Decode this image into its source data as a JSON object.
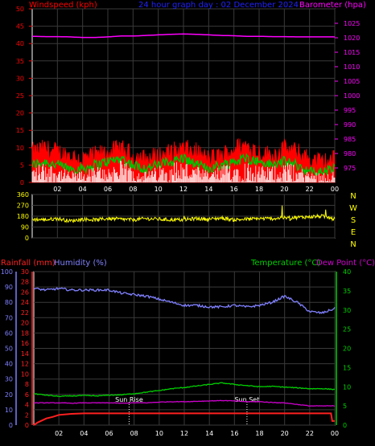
{
  "colors": {
    "background": "#000000",
    "frame": "#ffffff",
    "grid": "#3a3a3a",
    "wind_label": "#ff0000",
    "title": "#2020ff",
    "barometer": "#ff00ff",
    "direction": "#ffff00",
    "rain": "#ff2020",
    "humidity": "#8080ff",
    "temperature": "#00d000",
    "dewpoint": "#d000d0",
    "wind_avg": "#00c000",
    "gust_fill": "#ff0000",
    "wind_speed": "#ffffff"
  },
  "chart_data": [
    {
      "type": "line",
      "title": "24 hour graph day : 02 December 2024",
      "x_ticks": [
        "02",
        "04",
        "06",
        "08",
        "10",
        "12",
        "14",
        "16",
        "18",
        "20",
        "22",
        "00"
      ],
      "left_axis": {
        "label": "Windspeed (kph)",
        "ylim": [
          0,
          50
        ],
        "ticks": [
          "0",
          "5",
          "10",
          "15",
          "20",
          "25",
          "30",
          "35",
          "40",
          "45",
          "50"
        ]
      },
      "right_axis": {
        "label": "Barometer (hpa)",
        "ylim": [
          970,
          1030
        ],
        "ticks": [
          "975",
          "980",
          "985",
          "990",
          "995",
          "1000",
          "1005",
          "1010",
          "1015",
          "1020",
          "1025"
        ]
      },
      "series": [
        {
          "axis": "right",
          "values": [
            1020.5,
            1020.4,
            1020.4,
            1020.3,
            1020.1,
            1020.1,
            1020.3,
            1020.6,
            1020.6,
            1020.8,
            1021.0,
            1021.2,
            1021.3,
            1021.2,
            1021.0,
            1020.8,
            1020.7,
            1020.5,
            1020.5,
            1020.4,
            1020.4,
            1020.3,
            1020.3,
            1020.3,
            1020.3
          ]
        },
        {
          "values": [
            8,
            9,
            8,
            7,
            6,
            7,
            8,
            9,
            7,
            6,
            7,
            8,
            9,
            8,
            6,
            7,
            9,
            10,
            8,
            7,
            9,
            8,
            6,
            5,
            6
          ]
        },
        {
          "values": [
            5,
            6,
            5,
            4,
            4,
            5,
            6,
            7,
            5,
            4,
            5,
            6,
            7,
            5,
            4,
            5,
            6,
            7,
            6,
            5,
            6,
            5,
            3,
            3,
            4
          ]
        },
        {
          "values": [
            3,
            4,
            3,
            2,
            2,
            3,
            3,
            4,
            3,
            2,
            3,
            4,
            4,
            3,
            2,
            3,
            4,
            4,
            3,
            3,
            4,
            3,
            2,
            2,
            2
          ]
        }
      ]
    },
    {
      "type": "line",
      "x_ticks": [
        "02",
        "04",
        "06",
        "08",
        "10",
        "12",
        "14",
        "16",
        "18",
        "20",
        "22",
        "00"
      ],
      "left_axis": {
        "ylim": [
          0,
          360
        ],
        "ticks": [
          "0",
          "90",
          "180",
          "270",
          "360"
        ]
      },
      "right_axis": {
        "labels": [
          "N",
          "W",
          "S",
          "E",
          "N"
        ]
      },
      "series": [
        {
          "values": [
            155,
            150,
            160,
            140,
            155,
            150,
            160,
            155,
            150,
            160,
            155,
            150,
            150,
            160,
            155,
            165,
            150,
            155,
            160,
            160,
            165,
            170,
            175,
            180,
            155
          ]
        }
      ]
    },
    {
      "type": "line",
      "x_ticks": [
        "02",
        "04",
        "06",
        "08",
        "10",
        "12",
        "14",
        "16",
        "18",
        "20",
        "22",
        "00"
      ],
      "labels": {
        "rain": "Rainfall (mm)",
        "humidity": "Humidity (%)",
        "temp": "Temperature (°C)",
        "dew": "Dew Point (°C)"
      },
      "axes": {
        "humidity": {
          "ylim": [
            0,
            100
          ],
          "ticks": [
            "0",
            "10",
            "20",
            "30",
            "40",
            "50",
            "60",
            "70",
            "80",
            "90",
            "100"
          ]
        },
        "rain": {
          "ylim": [
            0,
            30
          ],
          "ticks": [
            "0",
            "2",
            "4",
            "6",
            "8",
            "10",
            "12",
            "14",
            "16",
            "18",
            "20",
            "22",
            "24",
            "26",
            "28",
            "30"
          ]
        },
        "temp": {
          "ylim": [
            0,
            40
          ],
          "ticks": [
            "0",
            "5",
            "10",
            "15",
            "20",
            "25",
            "30",
            "35",
            "40"
          ]
        }
      },
      "annotations": [
        {
          "text": "Sun Rise",
          "x_hour": 7.6
        },
        {
          "text": "Sun Set",
          "x_hour": 17.0
        }
      ],
      "series": [
        {
          "axis": "humidity",
          "x_hours": [
            0,
            1,
            2,
            3,
            4,
            5,
            6,
            7,
            8,
            9,
            10,
            11,
            12,
            13,
            14,
            15,
            16,
            17,
            18,
            19,
            20,
            21,
            22,
            23,
            24
          ],
          "values": [
            89,
            88,
            89,
            88,
            88,
            88,
            88,
            86,
            85,
            84,
            82,
            80,
            78,
            78,
            77,
            77,
            78,
            77,
            78,
            80,
            84,
            80,
            74,
            73,
            76
          ]
        },
        {
          "axis": "temp",
          "x_hours": [
            0,
            1,
            2,
            3,
            4,
            5,
            6,
            7,
            8,
            9,
            10,
            11,
            12,
            13,
            14,
            15,
            16,
            17,
            18,
            19,
            20,
            21,
            22,
            23,
            24
          ],
          "values": [
            8.2,
            7.8,
            7.5,
            7.6,
            7.7,
            7.6,
            7.8,
            7.9,
            8.2,
            8.6,
            9.0,
            9.5,
            9.8,
            10.2,
            10.6,
            11.0,
            10.6,
            10.3,
            10.0,
            10.1,
            9.9,
            9.7,
            9.5,
            9.5,
            9.3
          ]
        },
        {
          "axis": "temp",
          "x_hours": [
            0,
            1,
            2,
            3,
            4,
            5,
            6,
            7,
            8,
            9,
            10,
            11,
            12,
            13,
            14,
            15,
            16,
            17,
            18,
            19,
            20,
            21,
            22,
            23,
            24
          ],
          "values": [
            5.8,
            5.8,
            5.8,
            5.7,
            5.8,
            5.8,
            5.8,
            5.7,
            5.8,
            5.8,
            6.0,
            6.1,
            6.1,
            6.2,
            6.3,
            6.4,
            6.3,
            6.1,
            6.1,
            5.9,
            5.8,
            5.4,
            5.0,
            5.0,
            5.0
          ]
        },
        {
          "axis": "rain",
          "x_hours": [
            0,
            0.3,
            1,
            1.5,
            2,
            3,
            4,
            6,
            8,
            10,
            12,
            14,
            16,
            18,
            20,
            22,
            23.7,
            23.8,
            24
          ],
          "values": [
            0,
            0.5,
            1.3,
            1.6,
            2.0,
            2.2,
            2.3,
            2.3,
            2.3,
            2.3,
            2.3,
            2.3,
            2.3,
            2.3,
            2.3,
            2.3,
            2.3,
            0.8,
            0.8
          ]
        }
      ]
    }
  ]
}
